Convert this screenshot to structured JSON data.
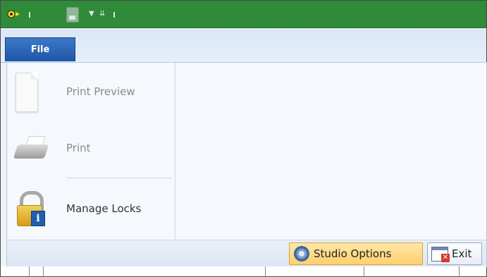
{
  "qat": {
    "icons": [
      "app-icon",
      "save-icon",
      "customize-dropdown-icon"
    ]
  },
  "tabs": {
    "file_label": "File"
  },
  "menu": {
    "items": [
      {
        "label": "Print Preview",
        "icon": "page-icon",
        "enabled": false
      },
      {
        "label": "Print",
        "icon": "printer-icon",
        "enabled": false
      },
      {
        "label": "Manage Locks",
        "icon": "lock-info-icon",
        "enabled": true
      }
    ]
  },
  "footer": {
    "studio_options_label": "Studio Options",
    "exit_label": "Exit"
  },
  "colors": {
    "qat_bg": "#2f8a3a",
    "file_tab": "#2a62b5",
    "studio_options_bg": "#ffd77a"
  }
}
